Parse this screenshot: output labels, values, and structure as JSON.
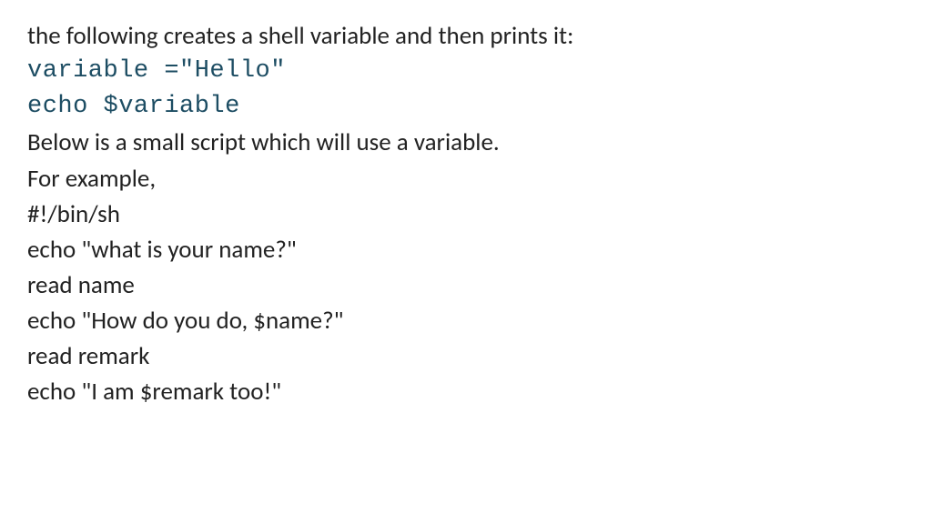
{
  "lines": {
    "intro": "the following creates a shell variable and then prints it:",
    "code1": "variable =\"Hello\"",
    "code2": "echo $variable",
    "desc": "Below is a small script which will use a variable.",
    "forexample": "For example,",
    "script1": "#!/bin/sh",
    "script2": "echo \"what is your name?\"",
    "script3": "read name",
    "script4": "echo \"How do you do, $name?\"",
    "script5": "read remark",
    "script6": "echo \"I am $remark too!\""
  }
}
